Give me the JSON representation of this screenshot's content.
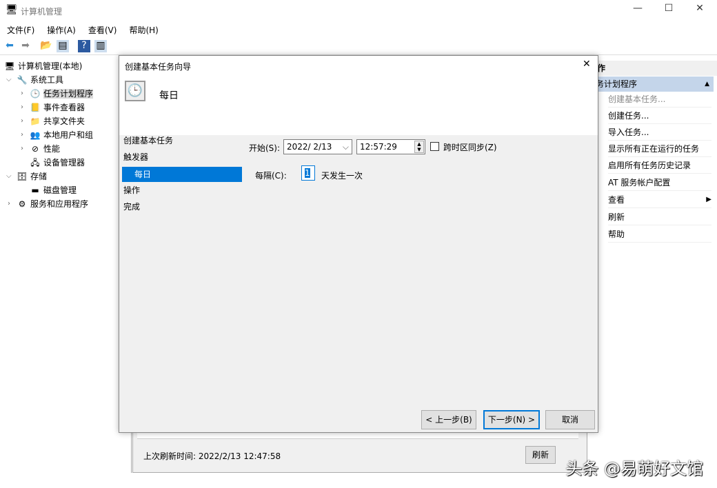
{
  "window": {
    "title": "计算机管理",
    "min": "—",
    "max": "☐",
    "close": "✕"
  },
  "menu": [
    "文件(F)",
    "操作(A)",
    "查看(V)",
    "帮助(H)"
  ],
  "tree": [
    {
      "label": "计算机管理(本地)",
      "icon": "computer-icon",
      "glyph": "🖥"
    },
    {
      "label": "系统工具",
      "icon": "tools-icon",
      "glyph": "🔧"
    },
    {
      "label": "任务计划程序",
      "icon": "clock-icon",
      "glyph": "🕒"
    },
    {
      "label": "事件查看器",
      "icon": "event-viewer-icon",
      "glyph": "📒"
    },
    {
      "label": "共享文件夹",
      "icon": "shared-folder-icon",
      "glyph": "📁"
    },
    {
      "label": "本地用户和组",
      "icon": "users-icon",
      "glyph": "👥"
    },
    {
      "label": "性能",
      "icon": "performance-icon",
      "glyph": "⊘"
    },
    {
      "label": "设备管理器",
      "icon": "device-manager-icon",
      "glyph": "🖧"
    },
    {
      "label": "存储",
      "icon": "storage-icon",
      "glyph": "🗄"
    },
    {
      "label": "磁盘管理",
      "icon": "disk-icon",
      "glyph": "▬"
    },
    {
      "label": "服务和应用程序",
      "icon": "services-icon",
      "glyph": "⚙"
    }
  ],
  "middle": {
    "last_refresh": "上次刷新时间: 2022/2/13 12:47:58",
    "refresh": "刷新"
  },
  "actions": {
    "header": "作",
    "section": "务计划程序",
    "items": [
      "创建基本任务...",
      "创建任务...",
      "导入任务...",
      "显示所有正在运行的任务",
      "启用所有任务历史记录",
      "AT 服务帐户配置",
      "查看",
      "刷新",
      "帮助"
    ]
  },
  "dialog": {
    "title": "创建基本任务向导",
    "heading": "每日",
    "close": "✕",
    "steps": [
      "创建基本任务",
      "触发器",
      "每日",
      "操作",
      "完成"
    ],
    "start_label": "开始(S):",
    "start_date": "2022/  2/13",
    "start_time": "12:57:29",
    "sync_label": "跨时区同步(Z)",
    "sync_checked": false,
    "recur_label": "每隔(C):",
    "recur_value": "1",
    "recur_suffix": "天发生一次",
    "back": "< 上一步(B)",
    "next": "下一步(N) >",
    "cancel": "取消"
  },
  "watermark": "头条 @易萌好文馆"
}
